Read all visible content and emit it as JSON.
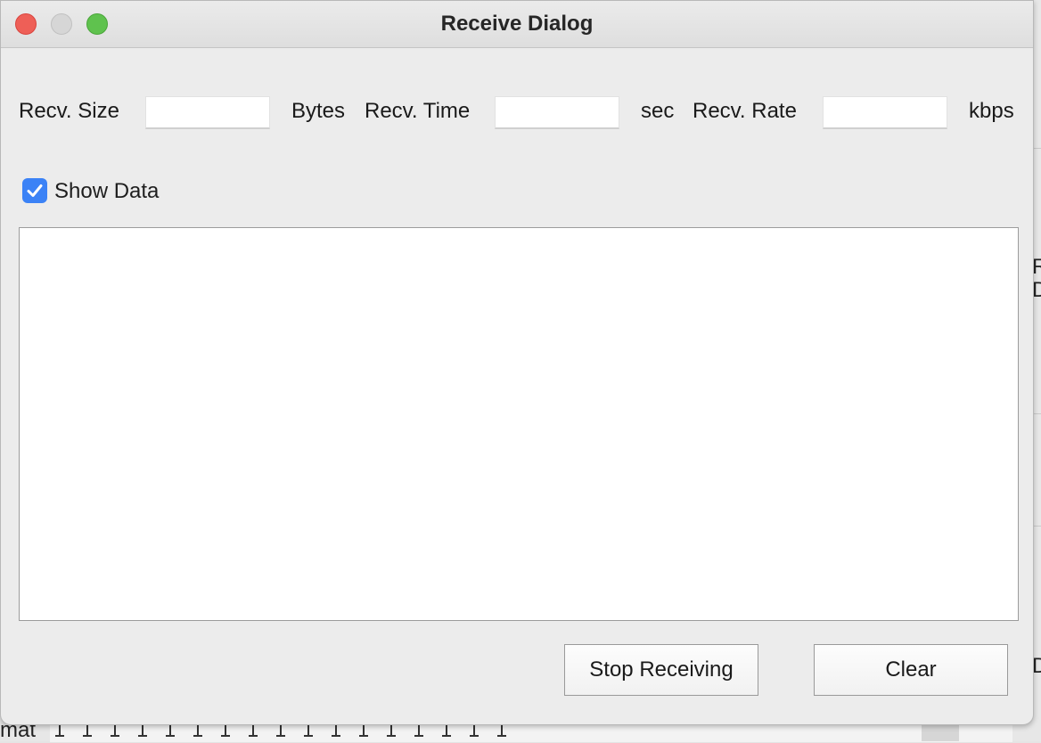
{
  "window": {
    "title": "Receive Dialog"
  },
  "stats": {
    "size_label": "Recv. Size",
    "size_value": "",
    "size_unit": "Bytes",
    "time_label": "Recv. Time",
    "time_value": "",
    "time_unit": "sec",
    "rate_label": "Recv. Rate",
    "rate_value": "",
    "rate_unit": "kbps"
  },
  "show_data": {
    "label": "Show Data",
    "checked": true
  },
  "output": {
    "text": ""
  },
  "buttons": {
    "stop": "Stop Receiving",
    "clear": "Clear"
  },
  "background": {
    "fragment_1": "R",
    "fragment_2": "D",
    "fragment_3": "D",
    "fragment_4": "mat"
  },
  "colors": {
    "accent": "#3b82f6",
    "close": "#ee5f57",
    "maximize": "#5fc24e"
  }
}
